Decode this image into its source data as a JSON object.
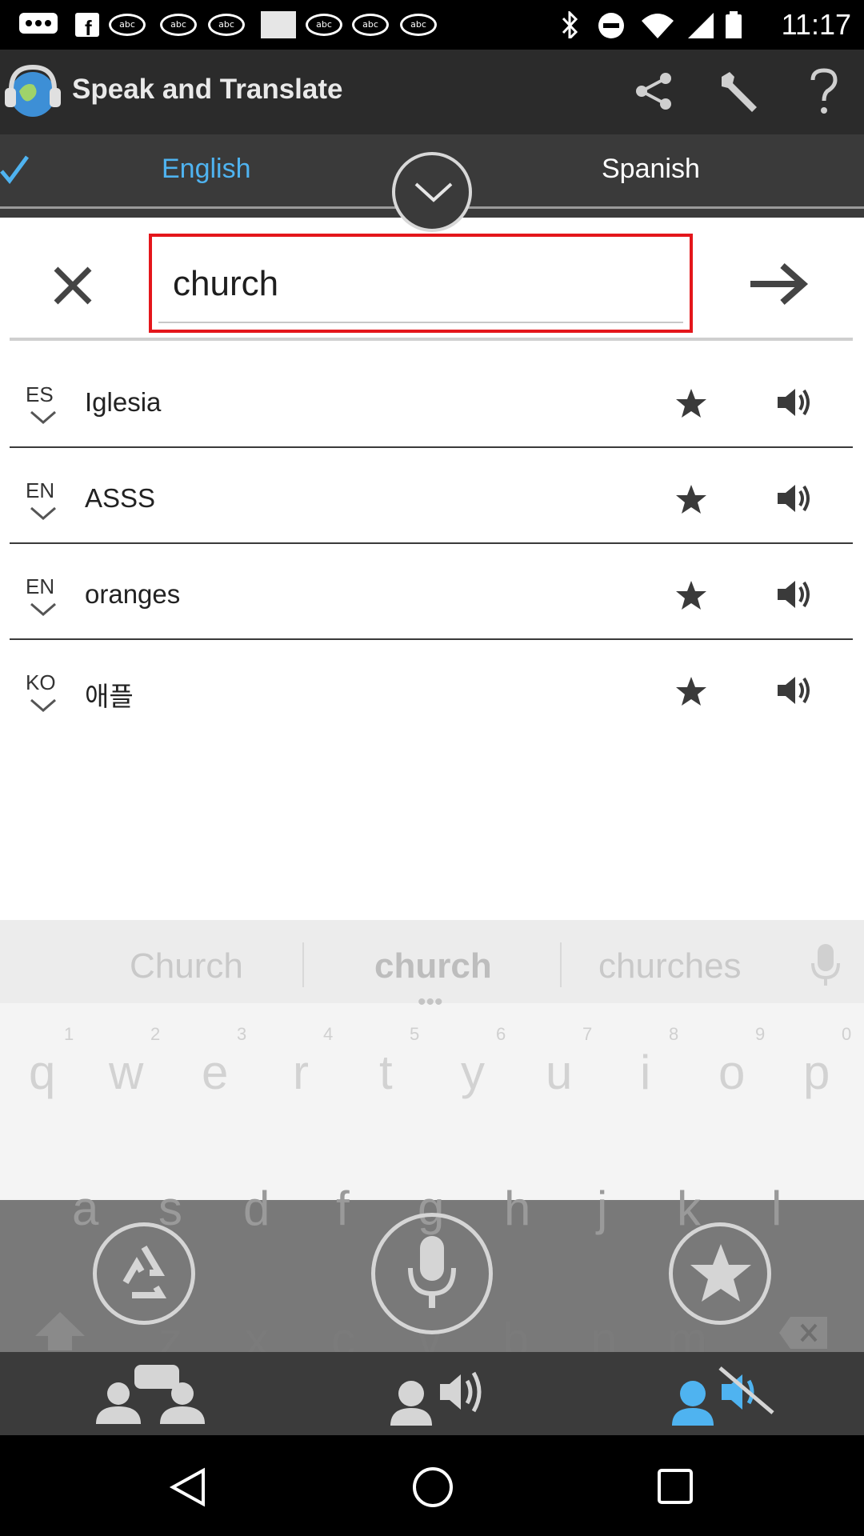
{
  "status_bar": {
    "time": "11:17",
    "notification_icons": [
      "chat-icon",
      "facebook-icon",
      "abc13-icon",
      "abc13-icon",
      "image-icon",
      "abc13-icon",
      "abc13-icon",
      "abc13-icon"
    ],
    "system_icons": [
      "bluetooth-icon",
      "do-not-disturb-icon",
      "wifi-icon",
      "signal-icon",
      "battery-icon"
    ]
  },
  "app_bar": {
    "title": "Speak and Translate",
    "actions": [
      "share-icon",
      "settings-wrench-icon",
      "help-icon"
    ]
  },
  "languages": {
    "source": "English",
    "target": "Spanish",
    "source_selected": true
  },
  "input": {
    "value": "church"
  },
  "history": [
    {
      "lang": "ES",
      "text": "Iglesia"
    },
    {
      "lang": "EN",
      "text": "ASSS"
    },
    {
      "lang": "EN",
      "text": "oranges"
    },
    {
      "lang": "KO",
      "text": "애플"
    }
  ],
  "keyboard": {
    "suggestions": [
      "Church",
      "church",
      "churches"
    ],
    "numbers": [
      "1",
      "2",
      "3",
      "4",
      "5",
      "6",
      "7",
      "8",
      "9",
      "0"
    ],
    "row1": [
      "q",
      "w",
      "e",
      "r",
      "t",
      "y",
      "u",
      "i",
      "o",
      "p"
    ],
    "row2": [
      "a",
      "s",
      "d",
      "f",
      "g",
      "h",
      "j",
      "k",
      "l"
    ],
    "row3": [
      "z",
      "x",
      "c",
      "v",
      "b",
      "n",
      "m"
    ]
  },
  "colors": {
    "app_bar": "#2b2b2b",
    "lang_bar": "#3a3a3a",
    "accent_blue": "#4fb3f0",
    "input_border": "#e4161b"
  }
}
